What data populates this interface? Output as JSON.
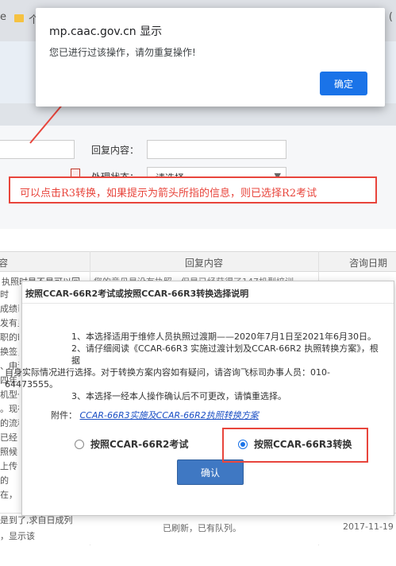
{
  "browser": {
    "tab_fragment": "e",
    "tab_fragment2": "个",
    "tab_close_fragment": "("
  },
  "form": {
    "reply_label": "回复内容：",
    "status_label": "处理状态：",
    "status_value": "请选择"
  },
  "table": {
    "col_content": "容",
    "col_reply": "回复内容",
    "col_date": "咨询日期",
    "row1_reply": "您的意见是没有执照，但是已经获得了147机型培训",
    "row1_left": "执照时是不是可以回",
    "bottom_reply": "已刷新，已有队列。",
    "bottom_date": "2017-11-19",
    "bottom_left1": "是到了,求自日成列",
    "bottom_left2": "，显示该",
    "left_fragments": [
      "时",
      "成绩已",
      "发有显",
      "职的时",
      "换签，",
      "、申请",
      "四年",
      "机型一",
      "。现在",
      "的流程",
      "已经",
      "照候",
      "上传",
      "的",
      "在，"
    ]
  },
  "alert": {
    "title": "mp.caac.gov.cn 显示",
    "message": "您已进行过该操作，请勿重复操作!",
    "ok_label": "确定"
  },
  "annotation": {
    "text": "可以点击R3转换，如果提示为箭头所指的信息，则已选择R2考试"
  },
  "modal": {
    "title": "按照CCAR-66R2考试或按照CCAR-66R3转换选择说明",
    "item1": "1、本选择适用于维修人员执照过渡期——2020年7月1日至2021年6月30日。",
    "item2a": "2、请仔细阅读《CCAR-66R3 实施过渡计划及CCAR-66R2 执照转换方案》，根据",
    "item2b": "自身实际情况进行选择。对于转换方案内容如有疑问，请咨询飞标司办事人员：010-64473555。",
    "item3": "3、本选择一经本人操作确认后不可更改，请慎重选择。",
    "attachment_label": "附件：",
    "attachment_link": "CCAR-66R3实施及CCAR-66R2执照转换方案",
    "option_r2": "按照CCAR-66R2考试",
    "option_r3": "按照CCAR-66R3转换",
    "selected": "option_r3",
    "confirm_label": "确认"
  },
  "colors": {
    "annotation": "#e8453c",
    "alert_button": "#1a73e8",
    "confirm_button": "#3f78c3",
    "link": "#1a4fc4"
  }
}
